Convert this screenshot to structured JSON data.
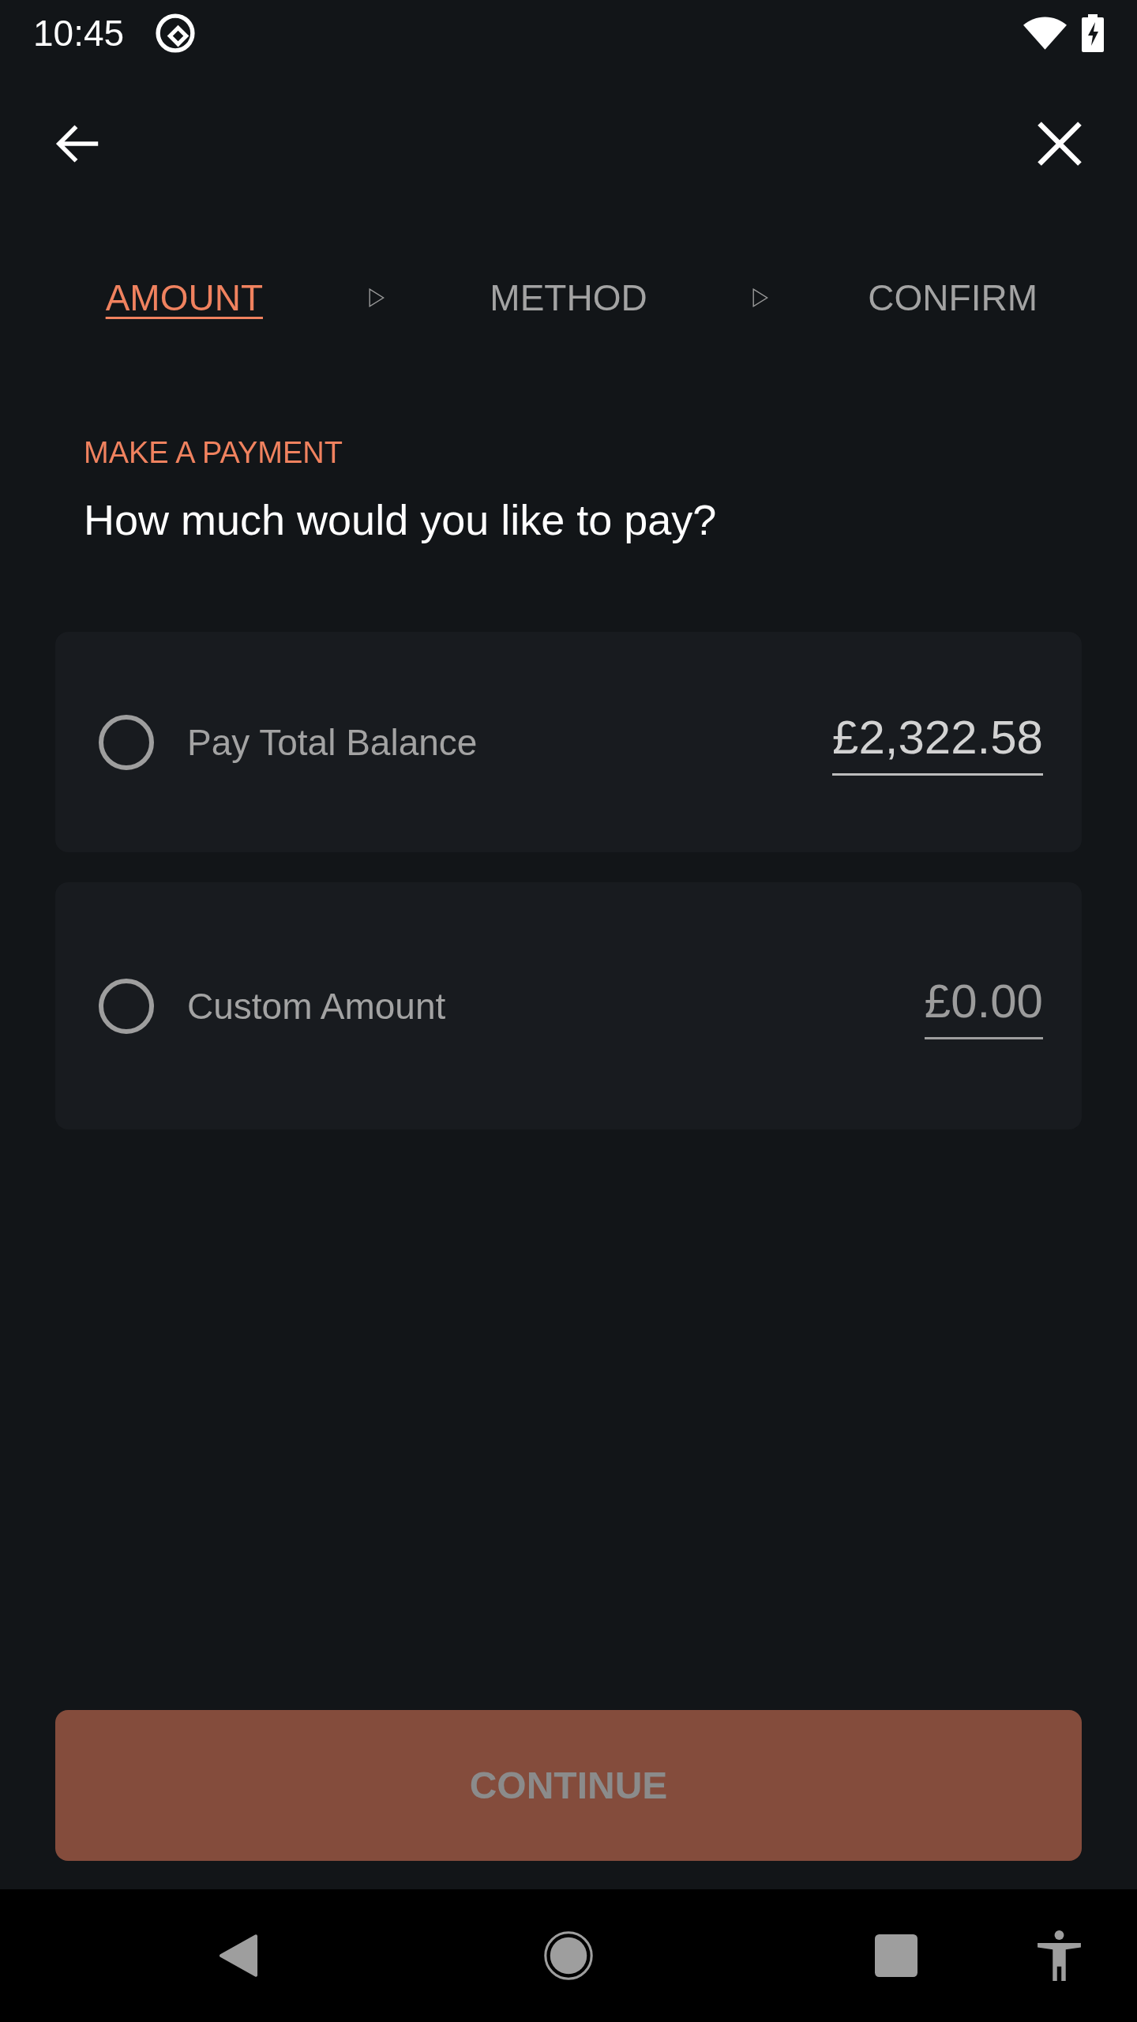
{
  "status_bar": {
    "time": "10:45"
  },
  "stepper": {
    "steps": [
      {
        "label": "AMOUNT",
        "selected": true
      },
      {
        "label": "METHOD",
        "selected": false
      },
      {
        "label": "CONFIRM",
        "selected": false
      }
    ]
  },
  "header": {
    "eyebrow": "MAKE A PAYMENT",
    "title": "How much would you like to pay?"
  },
  "options": [
    {
      "label": "Pay Total Balance",
      "selected": false,
      "amount": {
        "value": "£2,322.58"
      }
    },
    {
      "label": "Custom Amount",
      "selected": false,
      "amount": {
        "placeholder": "£0.00"
      }
    }
  ],
  "continue_button": {
    "label": "CONTINUE",
    "disabled": true
  }
}
